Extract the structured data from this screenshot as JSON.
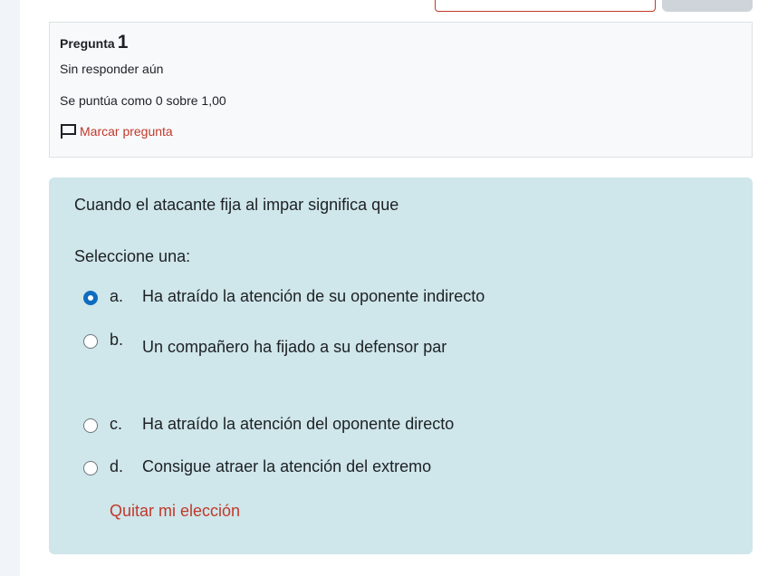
{
  "info": {
    "label": "Pregunta",
    "number": "1",
    "state": "Sin responder aún",
    "grade": "Se puntúa como 0 sobre 1,00",
    "flag_label": "Marcar pregunta"
  },
  "question": {
    "text": "Cuando el atacante fija al impar significa que",
    "prompt": "Seleccione una:",
    "options": [
      {
        "letter": "a.",
        "text": "Ha atraído la atención de su oponente indirecto",
        "selected": true
      },
      {
        "letter": "b.",
        "text": "Un compañero ha fijado a su defensor par",
        "selected": false
      },
      {
        "letter": "c.",
        "text": "Ha atraído la atención del oponente directo",
        "selected": false
      },
      {
        "letter": "d.",
        "text": "Consigue atraer la atención del extremo",
        "selected": false
      }
    ],
    "clear_choice": "Quitar mi elección"
  },
  "colors": {
    "accent": "#0f6cbf",
    "link_red": "#c0392b",
    "question_bg": "#cfe6ea"
  },
  "icons": {
    "flag": "flag-icon"
  }
}
